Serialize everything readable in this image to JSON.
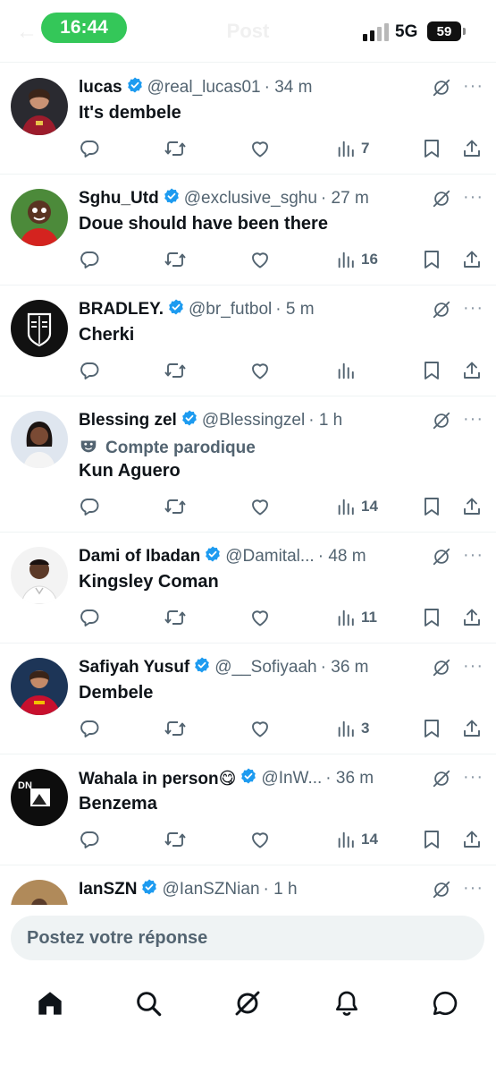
{
  "status_bar": {
    "time": "16:44",
    "network": "5G",
    "battery": "59",
    "ghost_title": "Post"
  },
  "tweets": [
    {
      "name": "lucas",
      "handle": "@real_lucas01",
      "time": "· 34 m",
      "text": "It's dembele",
      "views": "7",
      "avatar_icon": "avatar-lucas"
    },
    {
      "name": "Sghu_Utd",
      "handle": "@exclusive_sghu",
      "time": "· 27 m",
      "text": "Doue should have been there",
      "views": "16",
      "avatar_icon": "avatar-sghu"
    },
    {
      "name": "BRADLEY.",
      "handle": "@br_futbol",
      "time": "· 5 m",
      "text": "Cherki",
      "views": "",
      "avatar_icon": "avatar-br-logo"
    },
    {
      "name": "Blessing zel",
      "handle": "@Blessingzel",
      "time": "· 1 h",
      "parody": "Compte parodique",
      "text": "Kun Aguero",
      "views": "14",
      "avatar_icon": "avatar-blessing"
    },
    {
      "name": "Dami of Ibadan",
      "handle": "@Damital...",
      "time": "· 48 m",
      "text": "Kingsley Coman",
      "views": "11",
      "avatar_icon": "avatar-dami"
    },
    {
      "name": "Safiyah Yusuf",
      "handle": "@__Sofiyaah",
      "time": "· 36 m",
      "text": "Dembele",
      "views": "3",
      "avatar_icon": "avatar-safiyah"
    },
    {
      "name": "Wahala in person😋",
      "handle": "@InW...",
      "time": "· 36 m",
      "text": "Benzema",
      "views": "14",
      "avatar_icon": "avatar-wahala"
    },
    {
      "name": "IanSZN",
      "handle": "@IanSZNian",
      "time": "· 1 h",
      "text": "",
      "views": "",
      "avatar_icon": "avatar-ianszn"
    }
  ],
  "reply": {
    "placeholder": "Postez votre réponse"
  },
  "tabs": [
    "home-icon",
    "search-icon",
    "grok-icon",
    "notifications-icon",
    "messages-icon"
  ],
  "colors": {
    "verified": "#1d9bf0",
    "muted": "#536471",
    "status_pill": "#34c759"
  }
}
